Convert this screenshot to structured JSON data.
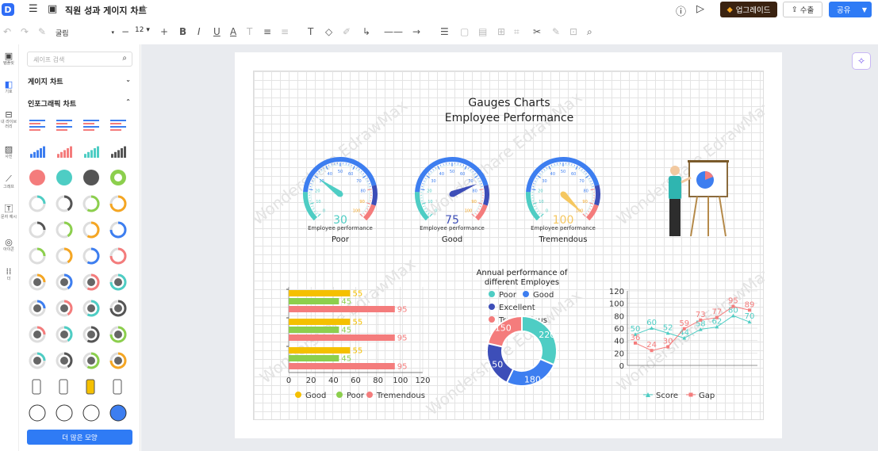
{
  "header": {
    "title": "직원 성과 게이지 차트",
    "upgrade_label": "업그레이드",
    "export_label": "수출",
    "share_label": "공유"
  },
  "toolbar": {
    "font_name": "굴림",
    "font_size": "12"
  },
  "rail": {
    "items": [
      {
        "label": "템플릿",
        "icon": "template-icon"
      },
      {
        "label": "기호",
        "icon": "symbol-icon"
      },
      {
        "label": "내 라이브러리",
        "icon": "library-icon"
      },
      {
        "label": "사진",
        "icon": "image-icon"
      },
      {
        "label": "그래프",
        "icon": "chart-icon"
      },
      {
        "label": "문자 예시",
        "icon": "text-icon"
      },
      {
        "label": "아이콘",
        "icon": "icon-icon"
      },
      {
        "label": "더",
        "icon": "more-icon"
      }
    ]
  },
  "library": {
    "search_placeholder": "셰이프 검색",
    "section_gauge": "게이지 차트",
    "section_infographic": "인포그래픽 차트",
    "more_shapes": "더 많은 모양"
  },
  "canvas": {
    "title_line1": "Gauges Charts",
    "title_line2": "Employee Performance",
    "watermark": "Wondershare EdrawMax",
    "gauges": [
      {
        "value": "30",
        "caption": "Employee performance",
        "label": "Poor",
        "color": "#4ecdc4"
      },
      {
        "value": "75",
        "caption": "Employee performance",
        "label": "Good",
        "color": "#3d4eb8"
      },
      {
        "value": "100",
        "caption": "Employee performance",
        "label": "Tremendous",
        "color": "#f5c760"
      }
    ],
    "gauge_ticks": [
      "0",
      "10",
      "20",
      "30",
      "40",
      "50",
      "60",
      "70",
      "80",
      "90",
      "100"
    ]
  },
  "chart_data": [
    {
      "type": "gauge",
      "gauges": [
        {
          "label": "Poor",
          "value": 30
        },
        {
          "label": "Good",
          "value": 75
        },
        {
          "label": "Tremendous",
          "value": 100
        }
      ],
      "ylim": [
        0,
        100
      ]
    },
    {
      "type": "bar",
      "orientation": "horizontal",
      "groups": 3,
      "series": [
        {
          "name": "Good",
          "color": "#f5c000",
          "values": [
            55,
            55,
            55
          ]
        },
        {
          "name": "Poor",
          "color": "#8ccf4d",
          "values": [
            45,
            45,
            45
          ]
        },
        {
          "name": "Tremendous",
          "color": "#f47c7c",
          "values": [
            95,
            95,
            95
          ]
        }
      ],
      "xlim": [
        0,
        120
      ],
      "xticks": [
        "0",
        "20",
        "40",
        "60",
        "80",
        "100",
        "120"
      ],
      "legend": "bottom"
    },
    {
      "type": "pie",
      "title": "Annual performance of different Employes",
      "donut": true,
      "slices": [
        {
          "name": "Poor",
          "value": 220,
          "color": "#4ecdc4"
        },
        {
          "name": "Good",
          "value": 180,
          "color": "#3d7ef0"
        },
        {
          "name": "Excellent",
          "value": 150,
          "color": "#3d4eb8"
        },
        {
          "name": "Tremendous",
          "value": 150,
          "color": "#f47c7c"
        }
      ],
      "legend": "top"
    },
    {
      "type": "line",
      "x": [
        1,
        2,
        3,
        4,
        5,
        6,
        7,
        8
      ],
      "series": [
        {
          "name": "Score",
          "color": "#4ecdc4",
          "values": [
            50,
            60,
            52,
            44,
            58,
            62,
            80,
            70
          ]
        },
        {
          "name": "Gap",
          "color": "#f47c7c",
          "values": [
            36,
            24,
            30,
            59,
            73,
            77,
            95,
            89
          ]
        }
      ],
      "ylim": [
        0,
        120
      ],
      "yticks": [
        "0",
        "20",
        "40",
        "60",
        "80",
        "100",
        "120"
      ],
      "legend": "bottom"
    }
  ]
}
